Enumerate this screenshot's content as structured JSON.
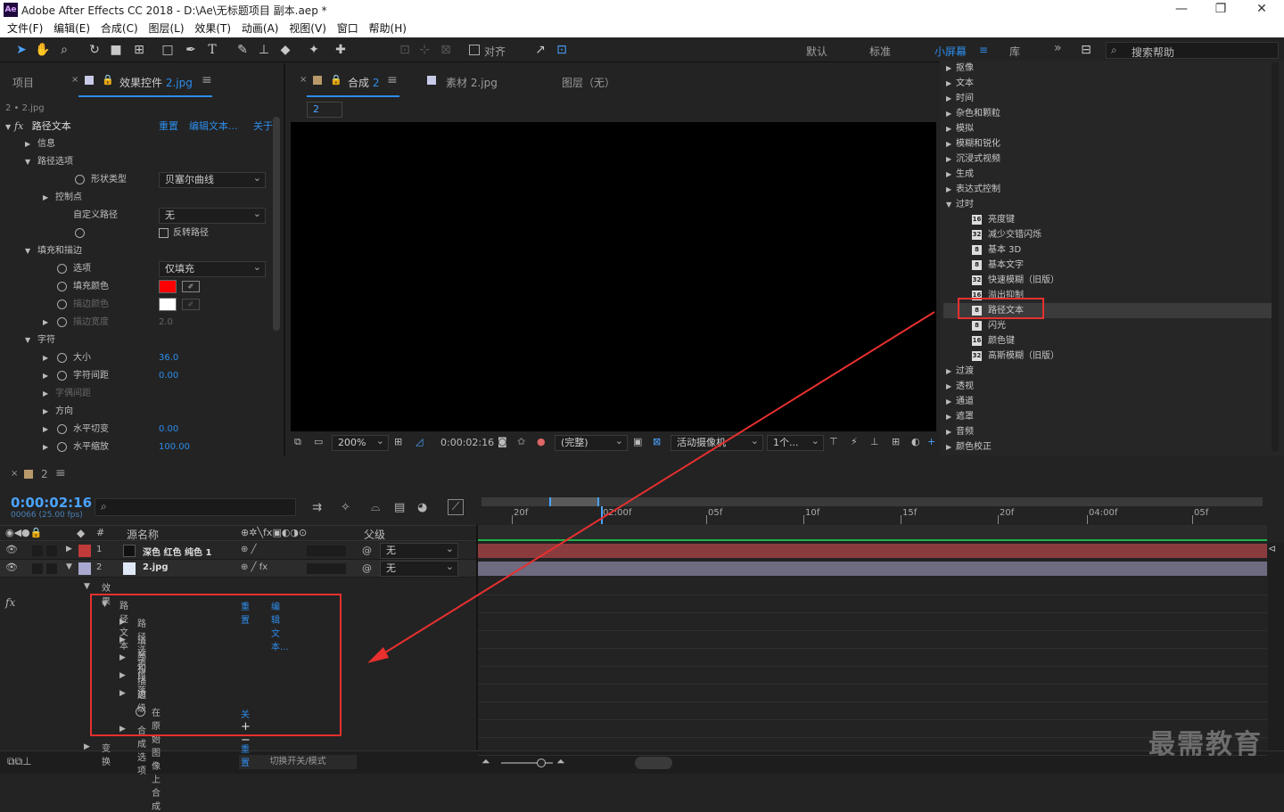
{
  "app": {
    "logo": "Ae",
    "title": "Adobe After Effects CC 2018 - D:\\Ae\\无标题项目 副本.aep *",
    "min": "—",
    "max": "❐",
    "close": "✕"
  },
  "menu": [
    "文件(F)",
    "编辑(E)",
    "合成(C)",
    "图层(L)",
    "效果(T)",
    "动画(A)",
    "视图(V)",
    "窗口",
    "帮助(H)"
  ],
  "toolbar": {
    "align_label": "对齐",
    "workspaces": [
      "默认",
      "标准",
      "小屏幕",
      "库"
    ],
    "active_workspace": "小屏幕",
    "more": "»",
    "search_placeholder": "搜索帮助"
  },
  "left_panel": {
    "tab_project": "项目",
    "tab_effects_prefix": "效果控件",
    "tab_effects_name": "2.jpg",
    "breadcrumb": "2 • 2.jpg",
    "effect_name": "路径文本",
    "reset": "重置",
    "edit_text": "编辑文本...",
    "about": "关于",
    "rows": [
      {
        "label": "信息",
        "indent": 1,
        "tri": "▶"
      },
      {
        "label": "路径选项",
        "indent": 1,
        "tri": "▼"
      },
      {
        "label": "形状类型",
        "indent": 3,
        "sw": true,
        "value": "贝塞尔曲线",
        "dd": true
      },
      {
        "label": "控制点",
        "indent": 2,
        "tri": "▶"
      },
      {
        "label": "自定义路径",
        "indent": 3,
        "value": "无",
        "dd": true
      },
      {
        "label": "",
        "indent": 3,
        "sw": true,
        "check": "反转路径"
      },
      {
        "label": "填充和描边",
        "indent": 1,
        "tri": "▼"
      },
      {
        "label": "选项",
        "indent": 2,
        "sw": true,
        "value": "仅填充",
        "dd": true
      },
      {
        "label": "填充颜色",
        "indent": 2,
        "sw": true,
        "color": "#ff0000"
      },
      {
        "label": "描边颜色",
        "indent": 2,
        "sw": true,
        "color": "#ffffff",
        "dim": true
      },
      {
        "label": "描边宽度",
        "indent": 2,
        "tri": "▶",
        "sw": true,
        "value": "2.0",
        "dim": true
      },
      {
        "label": "字符",
        "indent": 1,
        "tri": "▼"
      },
      {
        "label": "大小",
        "indent": 2,
        "tri": "▶",
        "sw": true,
        "value": "36.0",
        "blue": true
      },
      {
        "label": "字符间距",
        "indent": 2,
        "tri": "▶",
        "sw": true,
        "value": "0.00",
        "blue": true
      },
      {
        "label": "字偶间距",
        "indent": 2,
        "tri": "▶",
        "dim": true
      },
      {
        "label": "方向",
        "indent": 2,
        "tri": "▶"
      },
      {
        "label": "水平切变",
        "indent": 2,
        "tri": "▶",
        "sw": true,
        "value": "0.00",
        "blue": true
      },
      {
        "label": "水平缩放",
        "indent": 2,
        "tri": "▶",
        "sw": true,
        "value": "100.00",
        "blue": true
      }
    ]
  },
  "comp_panel": {
    "tab_comp_prefix": "合成",
    "tab_comp_num": "2",
    "tab_footage": "素材 2.jpg",
    "tab_layer": "图层（无）",
    "subtab": "2",
    "zoom": "200%",
    "timecode": "0:00:02:16",
    "resolution": "(完整)",
    "camera": "活动摄像机",
    "views": "1个..."
  },
  "effects_panel": {
    "items": [
      {
        "label": "抠像",
        "tri": "▶"
      },
      {
        "label": "文本",
        "tri": "▶"
      },
      {
        "label": "时间",
        "tri": "▶"
      },
      {
        "label": "杂色和颗粒",
        "tri": "▶"
      },
      {
        "label": "模拟",
        "tri": "▶"
      },
      {
        "label": "模糊和锐化",
        "tri": "▶"
      },
      {
        "label": "沉浸式视频",
        "tri": "▶"
      },
      {
        "label": "生成",
        "tri": "▶"
      },
      {
        "label": "表达式控制",
        "tri": "▶"
      },
      {
        "label": "过时",
        "tri": "▼"
      },
      {
        "label": "亮度键",
        "child": true,
        "badge": "16"
      },
      {
        "label": "减少交错闪烁",
        "child": true,
        "badge": "32"
      },
      {
        "label": "基本 3D",
        "child": true,
        "badge": "8"
      },
      {
        "label": "基本文字",
        "child": true,
        "badge": "8"
      },
      {
        "label": "快速模糊（旧版）",
        "child": true,
        "badge": "32"
      },
      {
        "label": "溢出抑制",
        "child": true,
        "badge": "16"
      },
      {
        "label": "路径文本",
        "child": true,
        "badge": "8",
        "selected": true
      },
      {
        "label": "闪光",
        "child": true,
        "badge": "8"
      },
      {
        "label": "颜色键",
        "child": true,
        "badge": "16"
      },
      {
        "label": "高斯模糊（旧版）",
        "child": true,
        "badge": "32"
      },
      {
        "label": "过渡",
        "tri": "▶"
      },
      {
        "label": "透视",
        "tri": "▶"
      },
      {
        "label": "通道",
        "tri": "▶"
      },
      {
        "label": "遮罩",
        "tri": "▶"
      },
      {
        "label": "音频",
        "tri": "▶"
      },
      {
        "label": "颜色校正",
        "tri": "▶"
      }
    ]
  },
  "timeline": {
    "tab": "2",
    "timecode": "0:00:02:16",
    "frames": "00066 (25.00 fps)",
    "search_placeholder": "",
    "col_num": "#",
    "col_source": "源名称",
    "col_parent": "父级",
    "ruler": [
      "20f",
      "02:00f",
      "05f",
      "10f",
      "15f",
      "20f",
      "04:00f",
      "05f"
    ],
    "layers": [
      {
        "num": "1",
        "name": "深色 红色 纯色 1",
        "color": "#c03a3a",
        "parent": "无"
      },
      {
        "num": "2",
        "name": "2.jpg",
        "color": "#a8a8d0",
        "parent": "无"
      }
    ],
    "tree": {
      "effects": "效果",
      "effect": "路径文本",
      "reset": "重置",
      "edit_text": "编辑文本...",
      "children": [
        "路径选项",
        "填充和描边",
        "字符",
        "段落",
        "高级"
      ],
      "composite_label": "在原始图像上合成",
      "composite_value": "关",
      "comp_options": "合成选项",
      "comp_options_icon": "+−",
      "transform": "变换",
      "transform_reset": "重置"
    },
    "bottom_toggle": "切换开关/模式"
  },
  "watermark": "最需教育",
  "colors": {
    "accent": "#2d8ceb",
    "highlight": "#e8302f",
    "layer1_bar": "#8a3b3e",
    "layer2_bar": "#6e6a80"
  }
}
